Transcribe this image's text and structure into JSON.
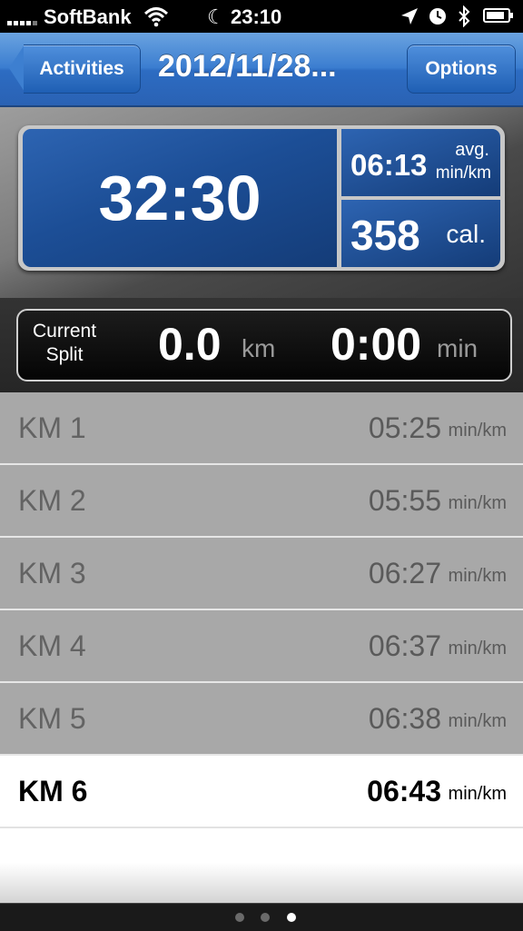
{
  "status_bar": {
    "carrier": "SoftBank",
    "time": "23:10",
    "icons": [
      "signal-icon",
      "wifi-icon",
      "moon-icon",
      "location-icon",
      "alarm-icon",
      "bluetooth-icon",
      "battery-icon"
    ]
  },
  "nav": {
    "back_label": "Activities",
    "title": "2012/11/28...",
    "options_label": "Options"
  },
  "stats": {
    "duration": "32:30",
    "avg_pace": "06:13",
    "avg_pace_label": "avg.",
    "avg_pace_unit": "min/km",
    "calories": "358",
    "calories_unit": "cal."
  },
  "current_split": {
    "label_line1": "Current",
    "label_line2": "Split",
    "distance": "0.0",
    "distance_unit": "km",
    "time": "0:00",
    "time_unit": "min"
  },
  "splits": [
    {
      "label": "KM 1",
      "pace": "05:25",
      "unit": "min/km"
    },
    {
      "label": "KM 2",
      "pace": "05:55",
      "unit": "min/km"
    },
    {
      "label": "KM 3",
      "pace": "06:27",
      "unit": "min/km"
    },
    {
      "label": "KM 4",
      "pace": "06:37",
      "unit": "min/km"
    },
    {
      "label": "KM 5",
      "pace": "06:38",
      "unit": "min/km"
    },
    {
      "label": "KM 6",
      "pace": "06:43",
      "unit": "min/km"
    }
  ],
  "pagination": {
    "total": 3,
    "current": 3
  },
  "colors": {
    "nav_blue": "#3b7dd0",
    "stat_blue": "#1c4e96",
    "list_gray": "#a8a8a8"
  }
}
